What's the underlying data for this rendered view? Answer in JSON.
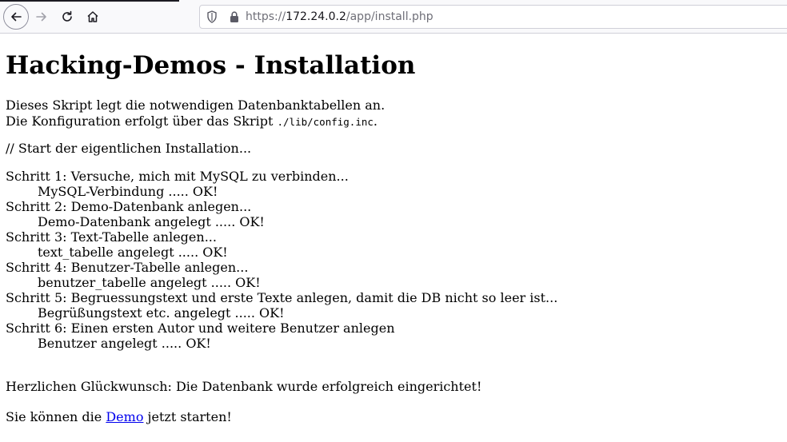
{
  "browser": {
    "url_protocol": "https://",
    "url_host": "172.24.0.2",
    "url_path": "/app/install.php",
    "icons": [
      "back-arrow-icon",
      "forward-arrow-icon",
      "reload-icon",
      "home-icon",
      "shield-icon",
      "lock-icon"
    ]
  },
  "page": {
    "title": "Hacking-Demos - Installation",
    "intro_line1": "Dieses Skript legt die notwendigen Datenbanktabellen an.",
    "intro_line2_prefix": "Die Konfiguration erfolgt über das Skript ",
    "intro_line2_code": "./lib/config.inc",
    "intro_line2_suffix": ".",
    "start_comment": "// Start der eigentlichen Installation...",
    "steps": [
      {
        "step": "Schritt 1: Versuche, mich mit MySQL zu verbinden...",
        "result": "MySQL-Verbindung ..... OK!"
      },
      {
        "step": "Schritt 2: Demo-Datenbank anlegen...",
        "result": "Demo-Datenbank angelegt ..... OK!"
      },
      {
        "step": "Schritt 3: Text-Tabelle anlegen...",
        "result": "text_tabelle angelegt ..... OK!"
      },
      {
        "step": "Schritt 4: Benutzer-Tabelle anlegen...",
        "result": "benutzer_tabelle angelegt ..... OK!"
      },
      {
        "step": "Schritt 5: Begruessungstext und erste Texte anlegen, damit die DB nicht so leer ist...",
        "result": "Begrüßungstext etc. angelegt ..... OK!"
      },
      {
        "step": "Schritt 6: Einen ersten Autor und weitere Benutzer anlegen",
        "result": "Benutzer angelegt ..... OK!"
      }
    ],
    "success_message": "Herzlichen Glückwunsch: Die Datenbank wurde erfolgreich eingerichtet!",
    "start_prefix": "Sie können die ",
    "start_link": "Demo",
    "start_suffix": " jetzt starten!"
  }
}
